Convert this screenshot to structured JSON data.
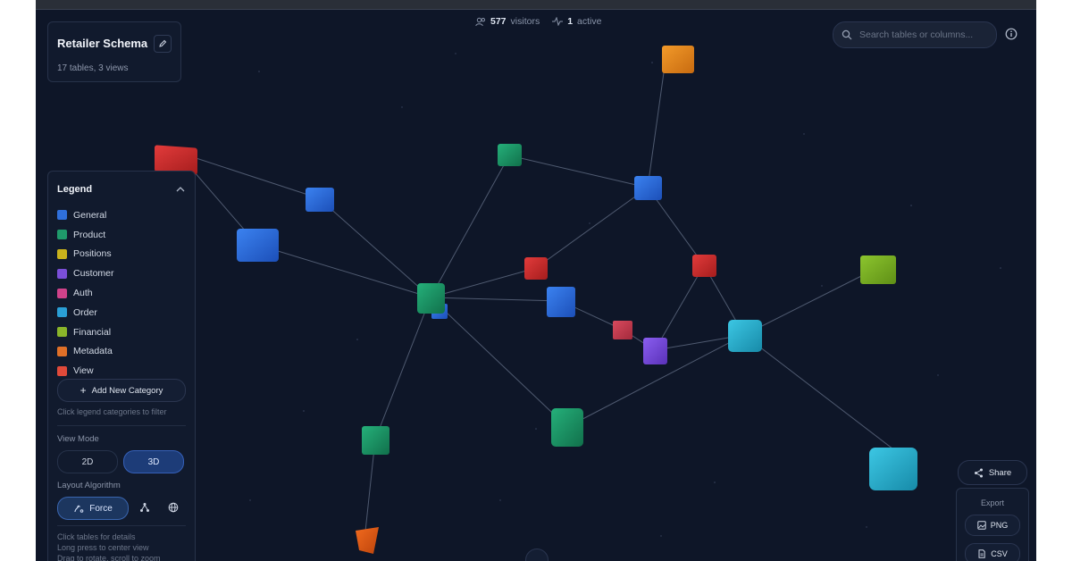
{
  "schema": {
    "title": "Retailer Schema",
    "subtitle": "17 tables, 3 views"
  },
  "stats": {
    "visitors_count": "577",
    "visitors_label": "visitors",
    "active_count": "1",
    "active_label": "active"
  },
  "search": {
    "placeholder": "Search tables or columns..."
  },
  "legend": {
    "title": "Legend",
    "items": [
      {
        "label": "General",
        "color": "#2f6fdb"
      },
      {
        "label": "Product",
        "color": "#1f9a6b"
      },
      {
        "label": "Positions",
        "color": "#c9b21c"
      },
      {
        "label": "Customer",
        "color": "#7b4fd8"
      },
      {
        "label": "Auth",
        "color": "#d0428a"
      },
      {
        "label": "Order",
        "color": "#2a9fd6"
      },
      {
        "label": "Financial",
        "color": "#8ab52a"
      },
      {
        "label": "Metadata",
        "color": "#e07028"
      },
      {
        "label": "View",
        "color": "#e04a3a"
      }
    ],
    "add_category_label": "Add New Category",
    "filter_hint": "Click legend categories to filter"
  },
  "view_mode": {
    "label": "View Mode",
    "options": [
      "2D",
      "3D"
    ],
    "active": "3D"
  },
  "layout_algorithm": {
    "label": "Layout Algorithm",
    "active": "Force"
  },
  "instructions": {
    "line1": "Click tables for details",
    "line2": "Long press to center view",
    "line3": "Drag to rotate, scroll to zoom"
  },
  "share_label": "Share",
  "export": {
    "label": "Export",
    "png_label": "PNG",
    "csv_label": "CSV"
  }
}
